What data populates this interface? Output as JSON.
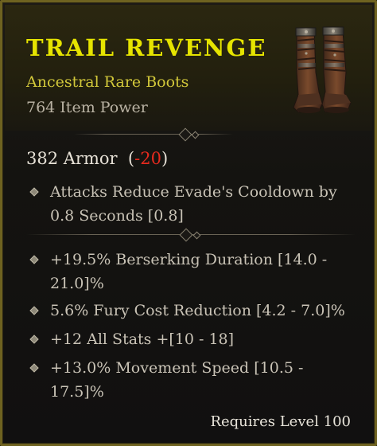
{
  "item": {
    "name": "TRAIL REVENGE",
    "type": "Ancestral Rare Boots",
    "power": "764 Item Power",
    "image_icon": "boots-icon",
    "name_color": "#e6e400",
    "type_color": "#d2c83a"
  },
  "armor": {
    "value": "382 Armor",
    "open_paren": "(",
    "diff": "-20",
    "close_paren": ")",
    "diff_color": "#e62a1e"
  },
  "implicit_affixes": [
    "Attacks Reduce Evade's Cooldown by 0.8 Seconds [0.8]"
  ],
  "affixes": [
    "+19.5% Berserking Duration [14.0 - 21.0]%",
    "5.6% Fury Cost Reduction [4.2 - 7.0]%",
    "+12 All Stats +[10 - 18]",
    "+13.0% Movement Speed [10.5 - 17.5]%"
  ],
  "requirement": "Requires Level 100"
}
